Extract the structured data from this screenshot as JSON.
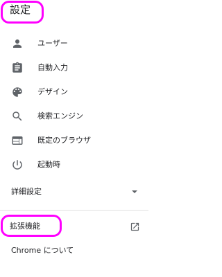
{
  "header": {
    "title": "設定"
  },
  "nav": {
    "items": [
      {
        "label": "ユーザー",
        "icon": "person-icon"
      },
      {
        "label": "自動入力",
        "icon": "clipboard-icon"
      },
      {
        "label": "デザイン",
        "icon": "palette-icon"
      },
      {
        "label": "検索エンジン",
        "icon": "search-icon"
      },
      {
        "label": "既定のブラウザ",
        "icon": "browser-icon"
      },
      {
        "label": "起動時",
        "icon": "power-icon"
      }
    ]
  },
  "advanced": {
    "label": "詳細設定",
    "icon": "caret-down-icon"
  },
  "extensions": {
    "label": "拡張機能",
    "icon": "open-in-new-icon"
  },
  "about": {
    "label": "Chrome について"
  },
  "colors": {
    "highlight": "#ff00ff",
    "icon": "#5f6368",
    "text": "#202124"
  }
}
